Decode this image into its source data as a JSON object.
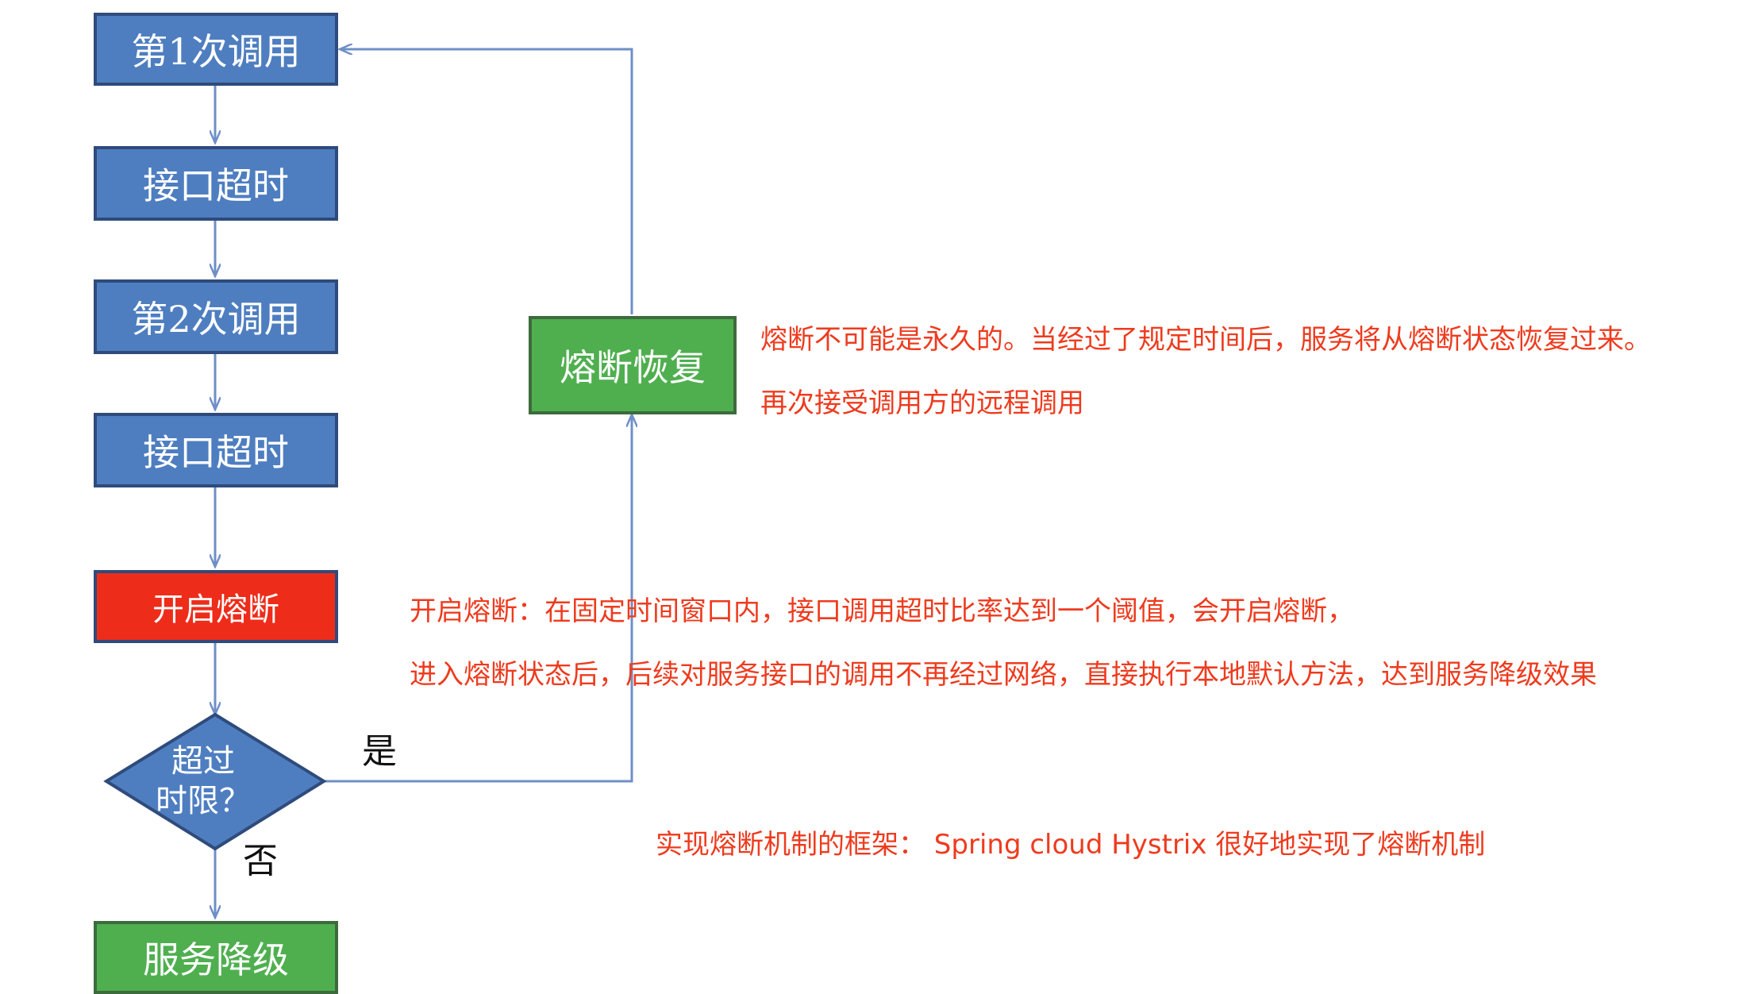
{
  "flow": {
    "step1": "第1次调用",
    "step2": "接口超时",
    "step3": "第2次调用",
    "step4": "接口超时",
    "step5": "开启熔断",
    "decision_line1": "超过",
    "decision_line2": "时限？",
    "result": "服务降级",
    "recover": "熔断恢复",
    "yes_label": "是",
    "no_label": "否"
  },
  "notes": {
    "recover_line1": "熔断不可能是永久的。当经过了规定时间后，服务将从熔断状态恢复过来。",
    "recover_line2": "再次接受调用方的远程调用",
    "open_line1": "开启熔断：在固定时间窗口内，接口调用超时比率达到一个阈值，会开启熔断，",
    "open_line2": "进入熔断状态后，后续对服务接口的调用不再经过网络，直接执行本地默认方法，达到服务降级效果",
    "framework": "实现熔断机制的框架：  Spring cloud Hystrix 很好地实现了熔断机制"
  },
  "colors": {
    "step_blue": "#4e7ec0",
    "open_red": "#ee2c1a",
    "green": "#4faf4f",
    "note_red": "#ee3b1e"
  }
}
